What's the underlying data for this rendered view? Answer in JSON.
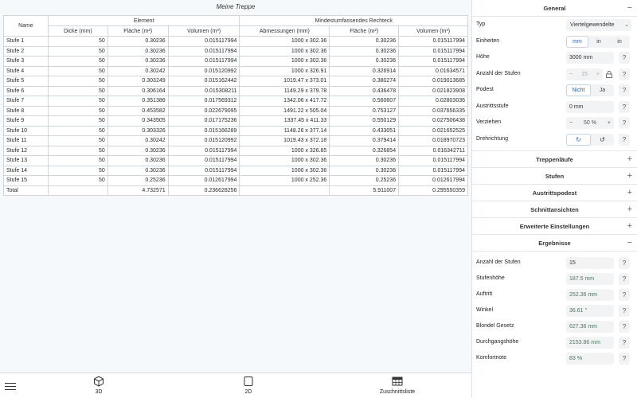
{
  "title": "Meine Treppe",
  "table": {
    "group_element": "Element",
    "group_rect": "Mindestumfassendes Rechteck",
    "col_name": "Name",
    "col_dicke": "Dicke (mm)",
    "col_flaeche": "Fläche (m²)",
    "col_volumen": "Volumen (m³)",
    "col_abm": "Abmessungen (mm)",
    "col_flaeche2": "Fläche (m²)",
    "col_volumen2": "Volumen (m³)",
    "rows": [
      [
        "Stufe 1",
        "50",
        "0.30236",
        "0.015117994",
        "1000 x 302.36",
        "0.30236",
        "0.015117994"
      ],
      [
        "Stufe 2",
        "50",
        "0.30236",
        "0.015117994",
        "1000 x 302.36",
        "0.30236",
        "0.015117994"
      ],
      [
        "Stufe 3",
        "50",
        "0.30236",
        "0.015117994",
        "1000 x 302.36",
        "0.30236",
        "0.015117994"
      ],
      [
        "Stufe 4",
        "50",
        "0.30242",
        "0.015120992",
        "1000 x 326.91",
        "0.326914",
        "0.01634571"
      ],
      [
        "Stufe 5",
        "50",
        "0.303249",
        "0.015162442",
        "1019.47 x 373.01",
        "0.380274",
        "0.019013685"
      ],
      [
        "Stufe 6",
        "50",
        "0.306164",
        "0.015308211",
        "1149.29 x 379.78",
        "0.436478",
        "0.021823908"
      ],
      [
        "Stufe 7",
        "50",
        "0.351386",
        "0.017569312",
        "1342.06 x 417.72",
        "0.560607",
        "0.02803036"
      ],
      [
        "Stufe 8",
        "50",
        "0.453582",
        "0.022679095",
        "1491.22 x 505.04",
        "0.753127",
        "0.037656335"
      ],
      [
        "Stufe 9",
        "50",
        "0.343505",
        "0.017175236",
        "1337.45 x 411.33",
        "0.550129",
        "0.027506438"
      ],
      [
        "Stufe 10",
        "50",
        "0.303326",
        "0.015166289",
        "1148.26 x 377.14",
        "0.433051",
        "0.021652525"
      ],
      [
        "Stufe 11",
        "50",
        "0.30242",
        "0.015120992",
        "1019.43 x 372.18",
        "0.379414",
        "0.018970723"
      ],
      [
        "Stufe 12",
        "50",
        "0.30236",
        "0.015117994",
        "1000 x 326.85",
        "0.326854",
        "0.016342711"
      ],
      [
        "Stufe 13",
        "50",
        "0.30236",
        "0.015117994",
        "1000 x 302.36",
        "0.30236",
        "0.015117994"
      ],
      [
        "Stufe 14",
        "50",
        "0.30236",
        "0.015117994",
        "1000 x 302.36",
        "0.30236",
        "0.015117994"
      ],
      [
        "Stufe 15",
        "50",
        "0.25236",
        "0.012617994",
        "1000 x 252.36",
        "0.25236",
        "0.012617994"
      ]
    ],
    "total": [
      "Total",
      "",
      "4.732571",
      "0.236628256",
      "",
      "5.911007",
      "0.295550359"
    ]
  },
  "bottombar": {
    "view3d": "3D",
    "view2d": "2D",
    "cutlist": "Zuschnittsliste"
  },
  "panel": {
    "general": {
      "title": "General",
      "toggle": "−",
      "typ_label": "Typ",
      "typ_value": "Viertelgewendelte",
      "einheiten_label": "Einheiten",
      "einheiten_options": [
        "mm",
        "in",
        "in"
      ],
      "hoehe_label": "Höhe",
      "hoehe_value": "3000 mm",
      "anzahl_label": "Anzahl der Stufen",
      "anzahl_value": "15",
      "podest_label": "Podest",
      "podest_options": [
        "Nicht",
        "Ja"
      ],
      "austritt_label": "Austrittsstufe",
      "austritt_value": "0 mm",
      "verziehen_label": "Verziehen",
      "verziehen_value": "50 %",
      "dreh_label": "Drehrichtung",
      "help": "?"
    },
    "sections": [
      {
        "title": "Treppenläufe",
        "toggle": "+"
      },
      {
        "title": "Stufen",
        "toggle": "+"
      },
      {
        "title": "Austrittspodest",
        "toggle": "+"
      },
      {
        "title": "Schnittansichten",
        "toggle": "+"
      },
      {
        "title": "Erweiterte Einstellungen",
        "toggle": "+"
      }
    ],
    "results": {
      "title": "Ergebnisse",
      "toggle": "−",
      "items": [
        {
          "label": "Anzahl der Stufen",
          "value": "15"
        },
        {
          "label": "Stufenhöhe",
          "value": "187.5 mm"
        },
        {
          "label": "Auftritt",
          "value": "252.36 mm"
        },
        {
          "label": "Winkel",
          "value": "36.61 °"
        },
        {
          "label": "Blondel Gesetz",
          "value": "627.36 mm"
        },
        {
          "label": "Durchgangshöhe",
          "value": "2153.86 mm"
        },
        {
          "label": "Komfortnote",
          "value": "83 %"
        }
      ]
    }
  }
}
